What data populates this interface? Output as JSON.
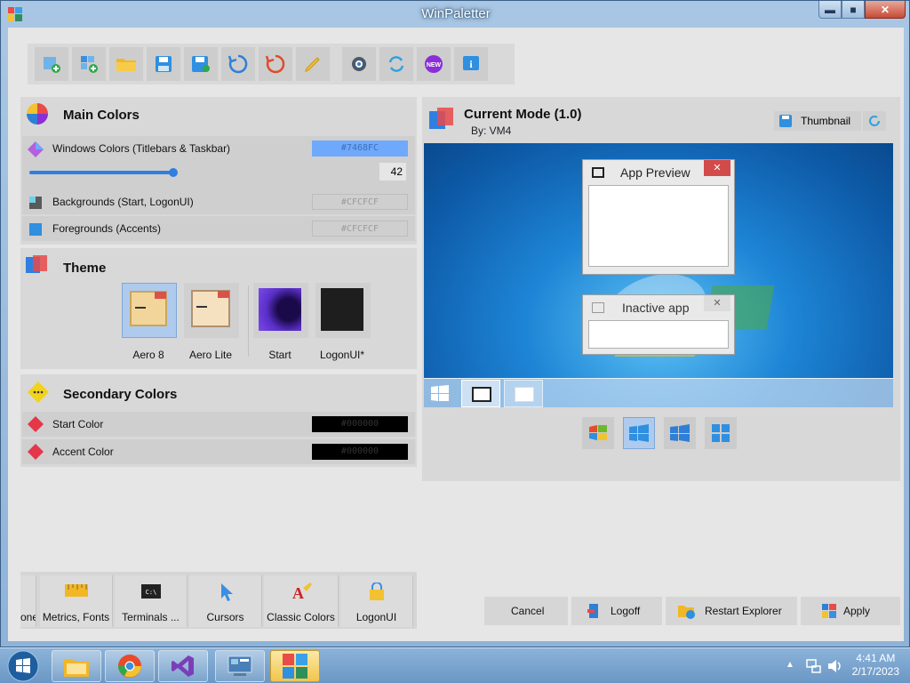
{
  "window": {
    "title": "WinPaletter",
    "min": "▬",
    "max": "■",
    "close": "✕"
  },
  "toolbar": {
    "buttons": [
      "new-from-current-icon",
      "new-from-preset-icon",
      "open-icon",
      "save-icon",
      "save-as-icon",
      "reset-icon",
      "restore-icon",
      "edit-icon",
      "settings-icon",
      "update-icon",
      "whats-new-icon",
      "about-icon"
    ],
    "new_badge": "NEW",
    "info_glyph": "i"
  },
  "main_colors": {
    "title": "Main Colors",
    "windows_colors": {
      "label": "Windows Colors (Titlebars & Taskbar)",
      "value": "#7468FC",
      "color": "#6fa9fb",
      "slider_value": "42"
    },
    "backgrounds": {
      "label": "Backgrounds (Start, LogonUI)",
      "value": "#CFCFCF",
      "color": "#cfcfcf"
    },
    "foregrounds": {
      "label": "Foregrounds (Accents)",
      "value": "#CFCFCF",
      "color": "#cfcfcf"
    }
  },
  "theme": {
    "title": "Theme",
    "options": [
      "Aero 8",
      "Aero Lite",
      "Start",
      "LogonUI*"
    ]
  },
  "secondary_colors": {
    "title": "Secondary Colors",
    "start_color": {
      "label": "Start Color",
      "value": "#000000"
    },
    "accent_color": {
      "label": "Accent Color",
      "value": "#000000"
    }
  },
  "preview": {
    "title": "Current Mode (1.0)",
    "author": "By: VM4",
    "thumbnail_label": "Thumbnail",
    "app_preview": "App Preview",
    "inactive_app": "Inactive app"
  },
  "tabs": [
    "one",
    "Metrics, Fonts",
    "Terminals ...",
    "Cursors",
    "Classic Colors",
    "LogonUI"
  ],
  "terminal_glyph": "C:\\",
  "actions": {
    "cancel": "Cancel",
    "logoff": "Logoff",
    "restart": "Restart Explorer",
    "apply": "Apply"
  },
  "clock": {
    "time": "4:41 AM",
    "date": "2/17/2023"
  }
}
